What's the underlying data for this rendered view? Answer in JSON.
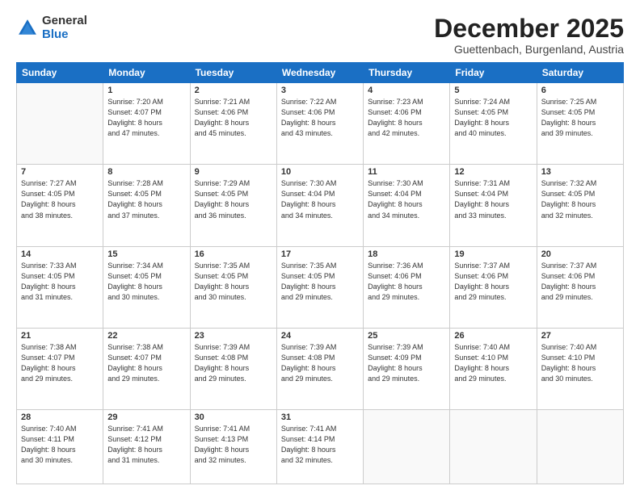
{
  "logo": {
    "general": "General",
    "blue": "Blue"
  },
  "header": {
    "month": "December 2025",
    "location": "Guettenbach, Burgenland, Austria"
  },
  "days_of_week": [
    "Sunday",
    "Monday",
    "Tuesday",
    "Wednesday",
    "Thursday",
    "Friday",
    "Saturday"
  ],
  "weeks": [
    [
      {
        "day": "",
        "info": ""
      },
      {
        "day": "1",
        "info": "Sunrise: 7:20 AM\nSunset: 4:07 PM\nDaylight: 8 hours\nand 47 minutes."
      },
      {
        "day": "2",
        "info": "Sunrise: 7:21 AM\nSunset: 4:06 PM\nDaylight: 8 hours\nand 45 minutes."
      },
      {
        "day": "3",
        "info": "Sunrise: 7:22 AM\nSunset: 4:06 PM\nDaylight: 8 hours\nand 43 minutes."
      },
      {
        "day": "4",
        "info": "Sunrise: 7:23 AM\nSunset: 4:06 PM\nDaylight: 8 hours\nand 42 minutes."
      },
      {
        "day": "5",
        "info": "Sunrise: 7:24 AM\nSunset: 4:05 PM\nDaylight: 8 hours\nand 40 minutes."
      },
      {
        "day": "6",
        "info": "Sunrise: 7:25 AM\nSunset: 4:05 PM\nDaylight: 8 hours\nand 39 minutes."
      }
    ],
    [
      {
        "day": "7",
        "info": "Sunrise: 7:27 AM\nSunset: 4:05 PM\nDaylight: 8 hours\nand 38 minutes."
      },
      {
        "day": "8",
        "info": "Sunrise: 7:28 AM\nSunset: 4:05 PM\nDaylight: 8 hours\nand 37 minutes."
      },
      {
        "day": "9",
        "info": "Sunrise: 7:29 AM\nSunset: 4:05 PM\nDaylight: 8 hours\nand 36 minutes."
      },
      {
        "day": "10",
        "info": "Sunrise: 7:30 AM\nSunset: 4:04 PM\nDaylight: 8 hours\nand 34 minutes."
      },
      {
        "day": "11",
        "info": "Sunrise: 7:30 AM\nSunset: 4:04 PM\nDaylight: 8 hours\nand 34 minutes."
      },
      {
        "day": "12",
        "info": "Sunrise: 7:31 AM\nSunset: 4:04 PM\nDaylight: 8 hours\nand 33 minutes."
      },
      {
        "day": "13",
        "info": "Sunrise: 7:32 AM\nSunset: 4:05 PM\nDaylight: 8 hours\nand 32 minutes."
      }
    ],
    [
      {
        "day": "14",
        "info": "Sunrise: 7:33 AM\nSunset: 4:05 PM\nDaylight: 8 hours\nand 31 minutes."
      },
      {
        "day": "15",
        "info": "Sunrise: 7:34 AM\nSunset: 4:05 PM\nDaylight: 8 hours\nand 30 minutes."
      },
      {
        "day": "16",
        "info": "Sunrise: 7:35 AM\nSunset: 4:05 PM\nDaylight: 8 hours\nand 30 minutes."
      },
      {
        "day": "17",
        "info": "Sunrise: 7:35 AM\nSunset: 4:05 PM\nDaylight: 8 hours\nand 29 minutes."
      },
      {
        "day": "18",
        "info": "Sunrise: 7:36 AM\nSunset: 4:06 PM\nDaylight: 8 hours\nand 29 minutes."
      },
      {
        "day": "19",
        "info": "Sunrise: 7:37 AM\nSunset: 4:06 PM\nDaylight: 8 hours\nand 29 minutes."
      },
      {
        "day": "20",
        "info": "Sunrise: 7:37 AM\nSunset: 4:06 PM\nDaylight: 8 hours\nand 29 minutes."
      }
    ],
    [
      {
        "day": "21",
        "info": "Sunrise: 7:38 AM\nSunset: 4:07 PM\nDaylight: 8 hours\nand 29 minutes."
      },
      {
        "day": "22",
        "info": "Sunrise: 7:38 AM\nSunset: 4:07 PM\nDaylight: 8 hours\nand 29 minutes."
      },
      {
        "day": "23",
        "info": "Sunrise: 7:39 AM\nSunset: 4:08 PM\nDaylight: 8 hours\nand 29 minutes."
      },
      {
        "day": "24",
        "info": "Sunrise: 7:39 AM\nSunset: 4:08 PM\nDaylight: 8 hours\nand 29 minutes."
      },
      {
        "day": "25",
        "info": "Sunrise: 7:39 AM\nSunset: 4:09 PM\nDaylight: 8 hours\nand 29 minutes."
      },
      {
        "day": "26",
        "info": "Sunrise: 7:40 AM\nSunset: 4:10 PM\nDaylight: 8 hours\nand 29 minutes."
      },
      {
        "day": "27",
        "info": "Sunrise: 7:40 AM\nSunset: 4:10 PM\nDaylight: 8 hours\nand 30 minutes."
      }
    ],
    [
      {
        "day": "28",
        "info": "Sunrise: 7:40 AM\nSunset: 4:11 PM\nDaylight: 8 hours\nand 30 minutes."
      },
      {
        "day": "29",
        "info": "Sunrise: 7:41 AM\nSunset: 4:12 PM\nDaylight: 8 hours\nand 31 minutes."
      },
      {
        "day": "30",
        "info": "Sunrise: 7:41 AM\nSunset: 4:13 PM\nDaylight: 8 hours\nand 32 minutes."
      },
      {
        "day": "31",
        "info": "Sunrise: 7:41 AM\nSunset: 4:14 PM\nDaylight: 8 hours\nand 32 minutes."
      },
      {
        "day": "",
        "info": ""
      },
      {
        "day": "",
        "info": ""
      },
      {
        "day": "",
        "info": ""
      }
    ]
  ]
}
